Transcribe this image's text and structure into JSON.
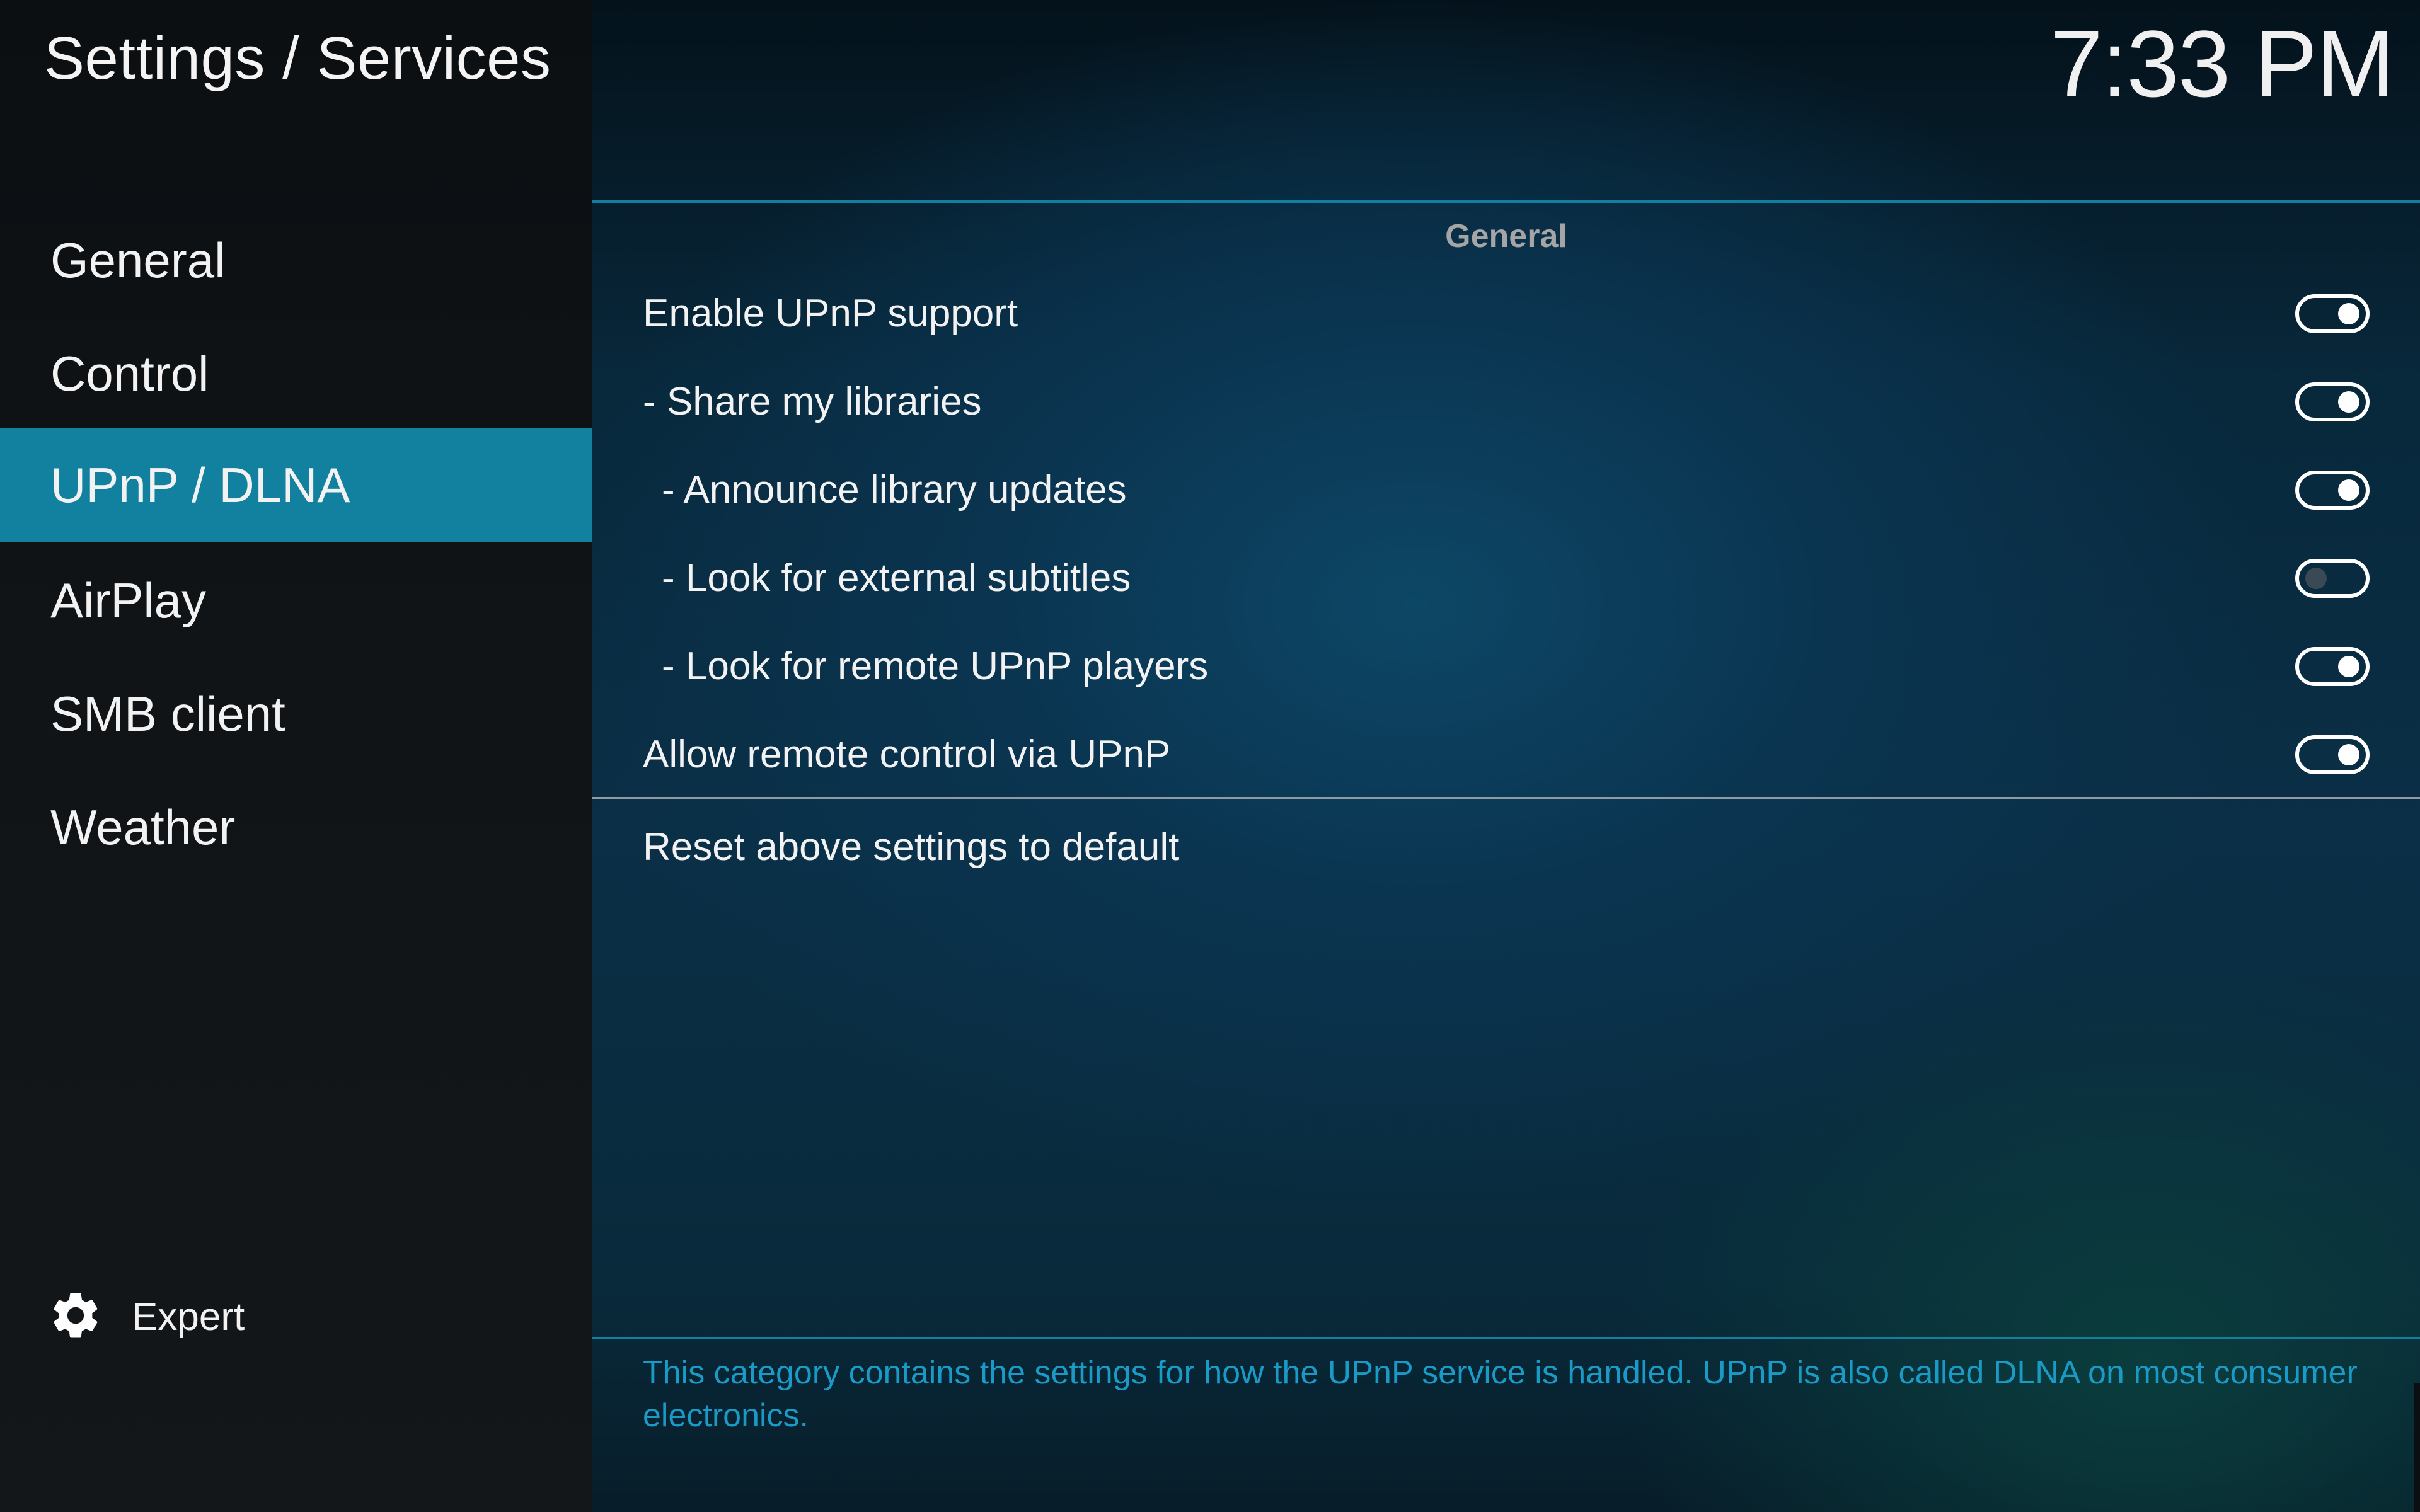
{
  "header": {
    "title": "Settings / Services",
    "clock": "7:33 PM"
  },
  "sidebar": {
    "items": [
      {
        "label": "General",
        "active": false
      },
      {
        "label": "Control",
        "active": false
      },
      {
        "label": "UPnP / DLNA",
        "active": true
      },
      {
        "label": "AirPlay",
        "active": false
      },
      {
        "label": "SMB client",
        "active": false
      },
      {
        "label": "Weather",
        "active": false
      }
    ],
    "expert_label": "Expert",
    "expert_icon": "gear-icon"
  },
  "main": {
    "section_heading": "General",
    "settings": [
      {
        "label": "Enable UPnP support",
        "enabled": true
      },
      {
        "label": "- Share my libraries",
        "enabled": true
      },
      {
        "label": "- Announce library updates",
        "enabled": true
      },
      {
        "label": "- Look for external subtitles",
        "enabled": false
      },
      {
        "label": "- Look for remote UPnP players",
        "enabled": true
      },
      {
        "label": "Allow remote control via UPnP",
        "enabled": true
      }
    ],
    "reset_label": "Reset above settings to default",
    "description": "This category contains the settings for how the UPnP service is handled. UPnP is also called DLNA on most consumer electronics."
  },
  "colors": {
    "accent": "#12819f",
    "description_text": "#1a9bc7",
    "heading_text": "#a5a5a5"
  }
}
